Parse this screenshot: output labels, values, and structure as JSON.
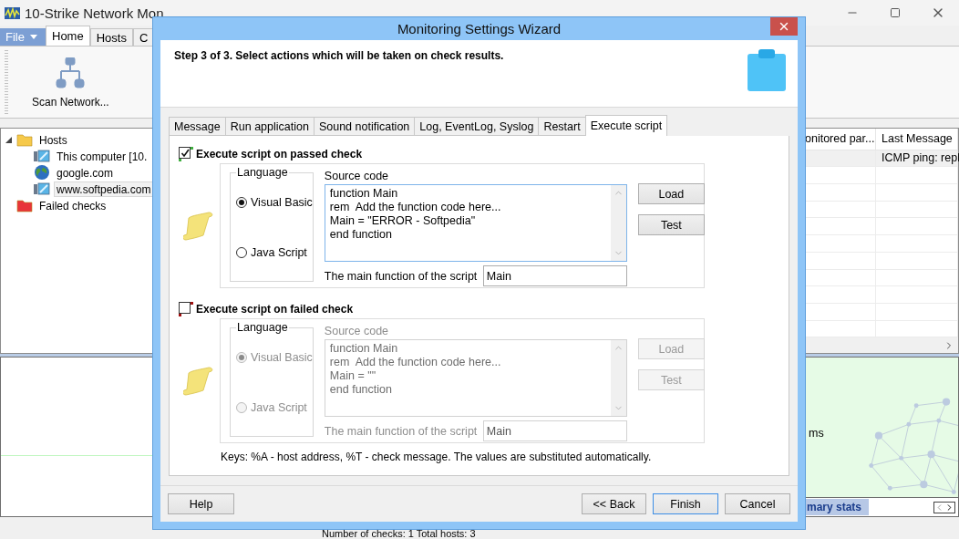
{
  "app": {
    "title": "10-Strike Network Mon",
    "ribbon_tabs": [
      {
        "label": "File",
        "kind": "menu",
        "selected": false
      },
      {
        "label": "Home",
        "kind": "tab",
        "selected": true
      },
      {
        "label": "Hosts",
        "kind": "tab",
        "selected": false
      },
      {
        "label": "C",
        "kind": "tab",
        "selected": false
      }
    ],
    "ribbon_buttons": [
      {
        "label": "Scan Network..."
      }
    ],
    "tree": [
      {
        "label": "Hosts",
        "kind": "folder",
        "color": "#f6c94a",
        "expanded": true,
        "selected": false,
        "children": [
          {
            "label": "This computer [10.",
            "kind": "computer",
            "selected": false
          },
          {
            "label": "google.com",
            "kind": "globe",
            "selected": false
          },
          {
            "label": "www.softpedia.com",
            "kind": "computer",
            "selected": true
          }
        ]
      },
      {
        "label": "Failed checks",
        "kind": "folder",
        "color": "#e8343a",
        "selected": false
      }
    ],
    "table": {
      "columns": [
        "onitored par...",
        "Last Message"
      ],
      "rows": [
        {
          "last_message": "ICMP ping: repl"
        }
      ]
    },
    "stats": {
      "reading": "ms",
      "tab": "mary stats"
    },
    "status_bar": "Number of checks: 1  Total hosts: 3"
  },
  "dialog": {
    "title": "Monitoring Settings Wizard",
    "step": "Step 3 of 3. Select actions which will be taken on check results.",
    "tabs": [
      {
        "label": "Message",
        "selected": false
      },
      {
        "label": "Run application",
        "selected": false
      },
      {
        "label": "Sound notification",
        "selected": false
      },
      {
        "label": "Log, EventLog, Syslog",
        "selected": false
      },
      {
        "label": "Restart",
        "selected": false
      },
      {
        "label": "Execute script",
        "selected": true
      }
    ],
    "sections": [
      {
        "label": "Execute script on passed check",
        "checked": true,
        "color": "#3fae3f",
        "disabled": false,
        "language_label": "Language",
        "languages": [
          {
            "label": "Visual Basic",
            "selected": true
          },
          {
            "label": "Java Script",
            "selected": false
          }
        ],
        "source_label": "Source code",
        "code": [
          "function Main",
          "rem  Add the function code here...",
          "Main = \"ERROR - Softpedia\"",
          "end function"
        ],
        "function_label": "The main function of the script",
        "function_value": "Main",
        "buttons": [
          "Load",
          "Test"
        ]
      },
      {
        "label": "Execute script on failed check",
        "checked": false,
        "color": "#a00f0f",
        "disabled": true,
        "language_label": "Language",
        "languages": [
          {
            "label": "Visual Basic",
            "selected": true
          },
          {
            "label": "Java Script",
            "selected": false
          }
        ],
        "source_label": "Source code",
        "code": [
          "function Main",
          "rem  Add the function code here...",
          "Main = \"\"",
          "end function"
        ],
        "function_label": "The main function of the script",
        "function_value": "Main",
        "buttons": [
          "Load",
          "Test"
        ]
      }
    ],
    "keys_note": "Keys: %A - host address, %T - check message. The values are substituted automatically.",
    "buttons": [
      {
        "label": "Help",
        "default": false
      },
      {
        "label": "<< Back",
        "default": false
      },
      {
        "label": "Finish",
        "default": true
      },
      {
        "label": "Cancel",
        "default": false
      }
    ]
  }
}
